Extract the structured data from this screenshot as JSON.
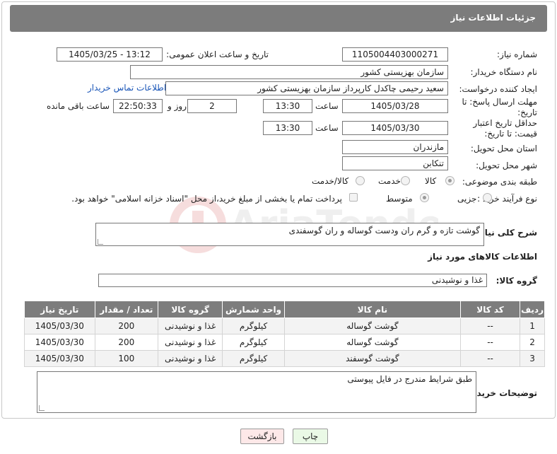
{
  "header": {
    "title": "جزئیات اطلاعات نیاز"
  },
  "fields": {
    "need_number_label": "شماره نیاز:",
    "need_number": "1105004403000271",
    "announce_label": "تاریخ و ساعت اعلان عمومی:",
    "announce_value": "1405/03/25 - 13:12",
    "buyer_org_label": "نام دستگاه خریدار:",
    "buyer_org": "سازمان بهزیستی کشور",
    "requester_label": "ایجاد کننده درخواست:",
    "requester": "سعید رحیمی چاکدل کارپرداز سازمان بهزیستی کشور",
    "contact_link": "اطلاعات تماس خریدار",
    "deadline_label": "مهلت ارسال پاسخ: تا تاریخ:",
    "deadline_date": "1405/03/28",
    "time_word": "ساعت",
    "deadline_time": "13:30",
    "days_value": "2",
    "days_and_label": "روز و",
    "remaining_time": "22:50:33",
    "remaining_label": "ساعت باقی مانده",
    "min_price_label": "حداقل تاریخ اعتبار قیمت: تا تاریخ:",
    "min_price_date": "1405/03/30",
    "min_price_time": "13:30",
    "province_label": "استان محل تحویل:",
    "province": "مازندران",
    "city_label": "شهر محل تحویل:",
    "city": "تنکابن",
    "category_label": "طبقه بندی موضوعی:",
    "category_options": [
      "کالا",
      "خدمت",
      "کالا/خدمت"
    ],
    "process_label": "نوع فرآیند خرید :",
    "process_options": [
      "جزیی",
      "متوسط"
    ],
    "payment_note": "پرداخت تمام یا بخشی از مبلغ خرید،از محل \"اسناد خزانه اسلامی\" خواهد بود."
  },
  "description": {
    "label": "شرح کلی نیاز:",
    "value": "گوشت تازه و گرم ران ودست گوساله و ران گوسفندی"
  },
  "goods": {
    "section_title": "اطلاعات کالاهای مورد نیاز",
    "group_label": "گروه کالا:",
    "group_value": "غذا و نوشیدنی",
    "columns": [
      "ردیف",
      "کد کالا",
      "نام کالا",
      "واحد شمارش",
      "گروه کالا",
      "تعداد / مقدار",
      "تاریخ نیاز"
    ],
    "rows": [
      [
        "1",
        "--",
        "گوشت گوساله",
        "کیلوگرم",
        "غذا و نوشیدنی",
        "200",
        "1405/03/30"
      ],
      [
        "2",
        "--",
        "گوشت گوساله",
        "کیلوگرم",
        "غذا و نوشیدنی",
        "200",
        "1405/03/30"
      ],
      [
        "3",
        "--",
        "گوشت گوسفند",
        "کیلوگرم",
        "غذا و نوشیدنی",
        "100",
        "1405/03/30"
      ]
    ]
  },
  "buyer_notes": {
    "label": "توضیحات خریدار:",
    "value": "طبق شرایط مندرج در فایل پیوستی"
  },
  "buttons": {
    "print": "چاپ",
    "back": "بازگشت"
  },
  "watermark": {
    "text": "AriaTender.net"
  },
  "colors": {
    "header_bg": "#7c7c7c",
    "link": "#1a56b8",
    "print_bg": "#eaf9e6",
    "back_bg": "#fde8e8"
  }
}
